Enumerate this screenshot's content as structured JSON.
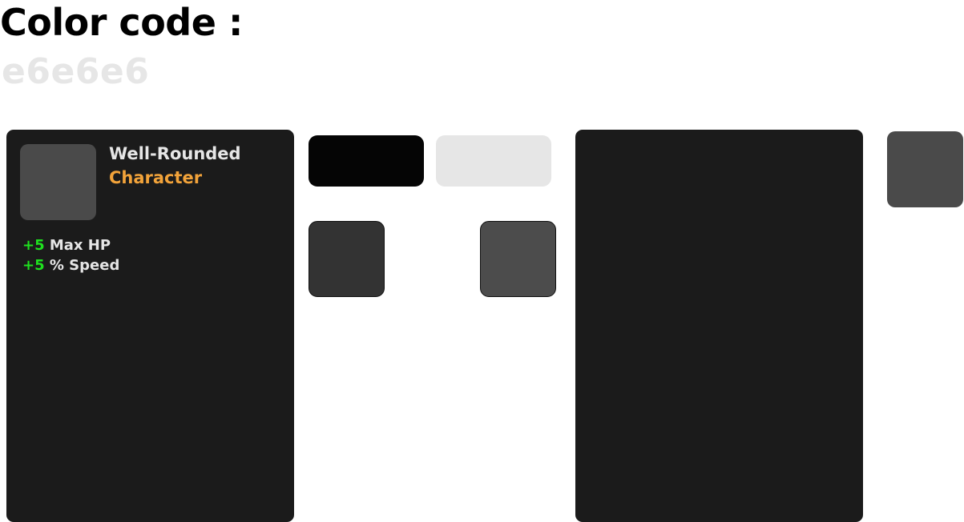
{
  "header": {
    "title": "Color code :",
    "code_value": "e6e6e6"
  },
  "card": {
    "title": "Well-Rounded",
    "subtitle": "Character",
    "stats": [
      {
        "value": "+5",
        "label": " Max HP"
      },
      {
        "value": "+5",
        "label": " % Speed"
      }
    ]
  },
  "colors": {
    "page_background": "#ffffff",
    "title_text": "#000000",
    "code_text": "#e6e6e6",
    "card_background": "#1b1b1b",
    "card_text": "#e6e6e6",
    "accent_orange": "#f2a33a",
    "stat_green": "#1fe01f",
    "swatch_black": "#050505",
    "swatch_light": "#e6e6e6",
    "swatch_dark": "#333333",
    "swatch_mid": "#4c4c4c",
    "icon_placeholder": "#4a4a4a"
  }
}
